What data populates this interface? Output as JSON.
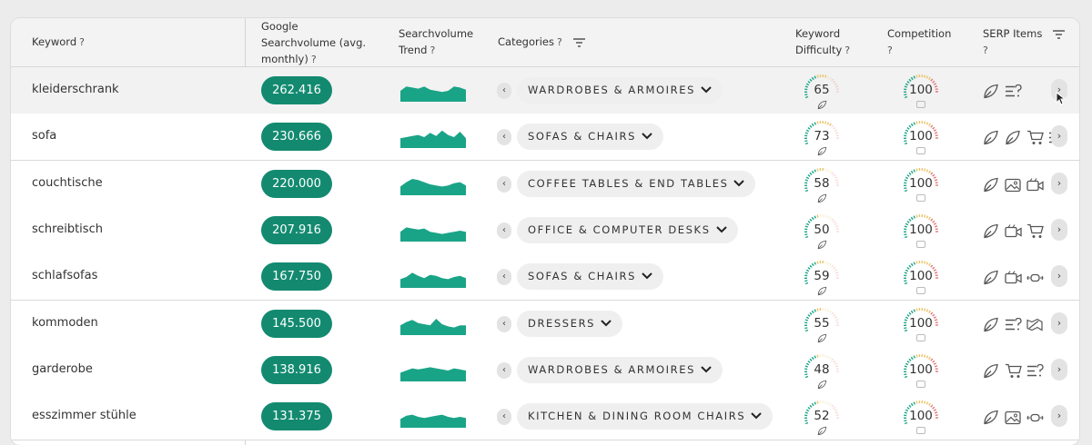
{
  "header": {
    "keyword": "Keyword",
    "volume": [
      "Google",
      "Searchvolume (avg.",
      "monthly)"
    ],
    "trend": [
      "Searchvolume",
      "Trend"
    ],
    "categories": "Categories",
    "difficulty": [
      "Keyword",
      "Difficulty"
    ],
    "competition": "Competition",
    "serp": "SERP Items",
    "help": "?"
  },
  "rows": [
    {
      "keyword": "kleiderschrank",
      "volume": "262.416",
      "category": "WARDROBES & ARMOIRES",
      "difficulty": "65",
      "competition": "100",
      "serp": [
        "leaf-icon",
        "list-question-icon"
      ]
    },
    {
      "keyword": "sofa",
      "volume": "230.666",
      "category": "SOFAS & CHAIRS",
      "difficulty": "73",
      "competition": "100",
      "serp": [
        "leaf-icon",
        "leaf-icon",
        "cart-icon",
        "list-question-icon"
      ]
    },
    {
      "keyword": "couchtische",
      "volume": "220.000",
      "category": "COFFEE TABLES & END TABLES",
      "difficulty": "58",
      "competition": "100",
      "serp": [
        "leaf-icon",
        "image-icon",
        "video-icon"
      ]
    },
    {
      "keyword": "schreibtisch",
      "volume": "207.916",
      "category": "OFFICE & COMPUTER DESKS",
      "difficulty": "50",
      "competition": "100",
      "serp": [
        "leaf-icon",
        "video-icon",
        "cart-icon"
      ]
    },
    {
      "keyword": "schlafsofas",
      "volume": "167.750",
      "category": "SOFAS & CHAIRS",
      "difficulty": "59",
      "competition": "100",
      "serp": [
        "leaf-icon",
        "video-icon",
        "carousel-icon"
      ]
    },
    {
      "keyword": "kommoden",
      "volume": "145.500",
      "category": "DRESSERS",
      "difficulty": "55",
      "competition": "100",
      "serp": [
        "leaf-icon",
        "list-question-icon",
        "map-icon"
      ]
    },
    {
      "keyword": "garderobe",
      "volume": "138.916",
      "category": "WARDROBES & ARMOIRES",
      "difficulty": "48",
      "competition": "100",
      "serp": [
        "leaf-icon",
        "cart-icon",
        "list-question-icon"
      ]
    },
    {
      "keyword": "esszimmer stühle",
      "volume": "131.375",
      "category": "KITCHEN & DINING ROOM CHAIRS",
      "difficulty": "52",
      "competition": "100",
      "serp": [
        "leaf-icon",
        "image-icon",
        "carousel-icon"
      ]
    }
  ],
  "trend_series": [
    [
      0.5,
      0.7,
      0.65,
      0.6,
      0.7,
      0.55,
      0.5,
      0.45,
      0.5,
      0.7,
      0.65,
      0.55
    ],
    [
      0.45,
      0.5,
      0.55,
      0.6,
      0.5,
      0.7,
      0.55,
      0.8,
      0.6,
      0.5,
      0.75,
      0.45
    ],
    [
      0.4,
      0.6,
      0.75,
      0.7,
      0.6,
      0.5,
      0.45,
      0.4,
      0.45,
      0.55,
      0.6,
      0.45
    ],
    [
      0.45,
      0.65,
      0.6,
      0.55,
      0.6,
      0.45,
      0.4,
      0.35,
      0.4,
      0.45,
      0.5,
      0.45
    ],
    [
      0.4,
      0.5,
      0.7,
      0.55,
      0.45,
      0.6,
      0.55,
      0.45,
      0.4,
      0.5,
      0.55,
      0.45
    ],
    [
      0.45,
      0.6,
      0.7,
      0.55,
      0.5,
      0.45,
      0.75,
      0.5,
      0.4,
      0.35,
      0.45,
      0.45
    ],
    [
      0.4,
      0.5,
      0.6,
      0.55,
      0.6,
      0.65,
      0.6,
      0.55,
      0.5,
      0.6,
      0.55,
      0.5
    ],
    [
      0.4,
      0.55,
      0.6,
      0.5,
      0.45,
      0.5,
      0.55,
      0.6,
      0.5,
      0.45,
      0.5,
      0.45
    ]
  ],
  "colors": {
    "accent": "#138a70",
    "trend": "#1aa487",
    "gauge_low": "#1aa487",
    "gauge_mid": "#e9c46a",
    "gauge_high": "#e07a7a"
  }
}
